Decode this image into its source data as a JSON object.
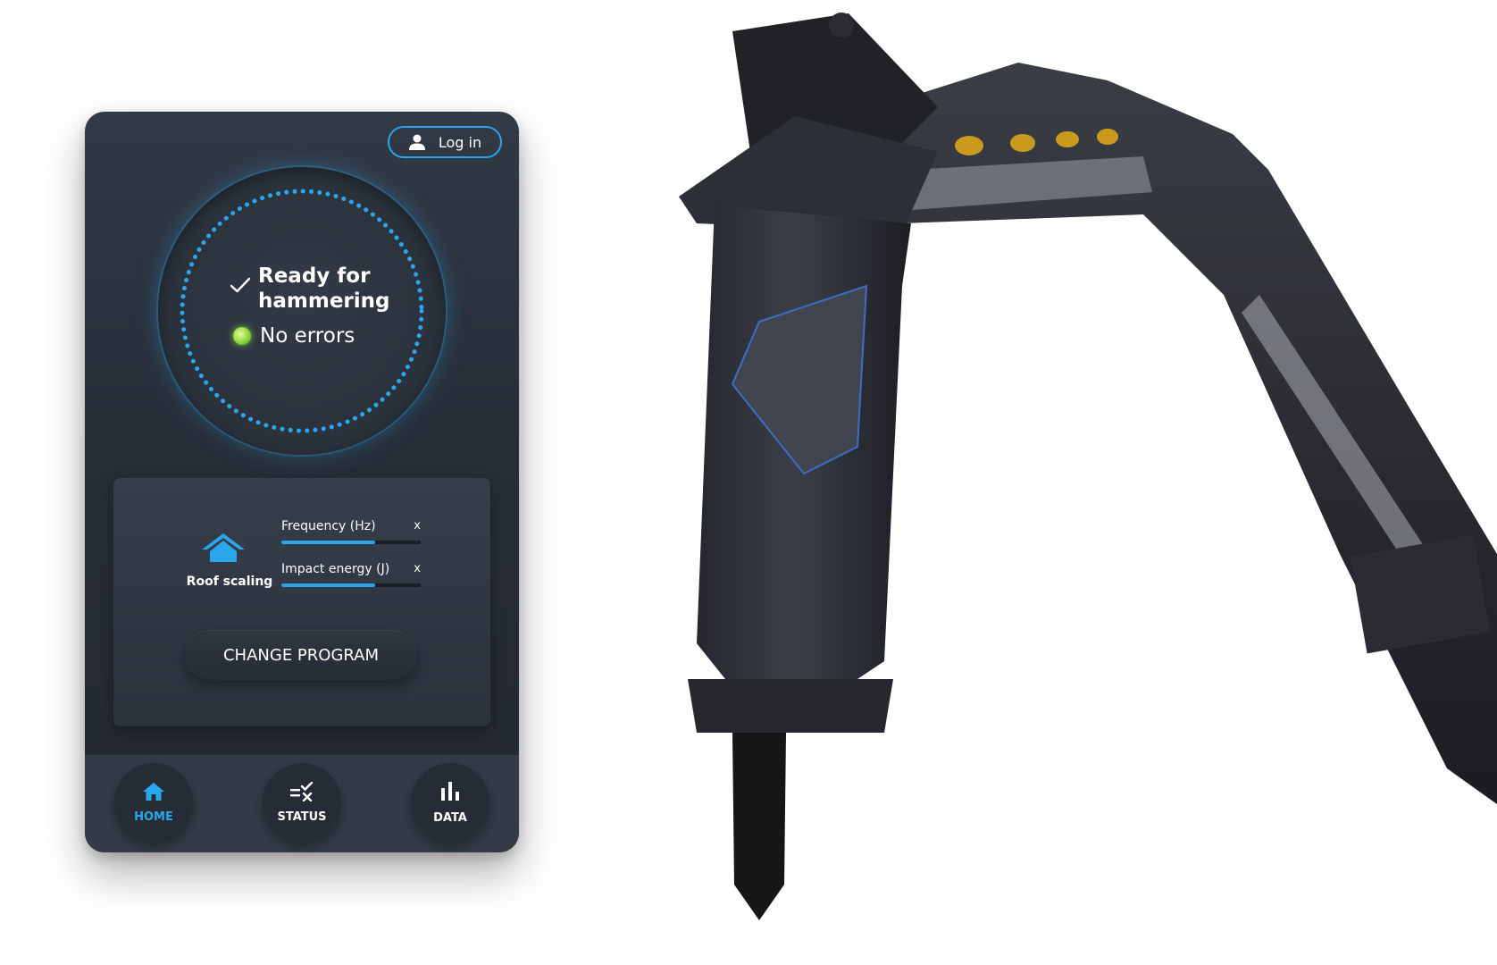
{
  "header": {
    "login_label": "Log in"
  },
  "status": {
    "ready_line1": "Ready for",
    "ready_line2": "hammering",
    "errors_text": "No errors"
  },
  "program": {
    "name": "Roof scaling",
    "metrics": [
      {
        "label": "Frequency (Hz)",
        "value_text": "x",
        "level_fraction": 0.67
      },
      {
        "label": "Impact energy (J)",
        "value_text": "x",
        "level_fraction": 0.67
      }
    ],
    "change_label": "CHANGE PROGRAM"
  },
  "nav": {
    "items": [
      {
        "label": "HOME",
        "icon": "home-icon",
        "active": true
      },
      {
        "label": "STATUS",
        "icon": "status-icon",
        "active": false
      },
      {
        "label": "DATA",
        "icon": "bar-chart-icon",
        "active": false
      }
    ]
  },
  "colors": {
    "accent": "#2aa7ec",
    "panel": "#2b323c",
    "status_ok": "#8fd63a"
  }
}
